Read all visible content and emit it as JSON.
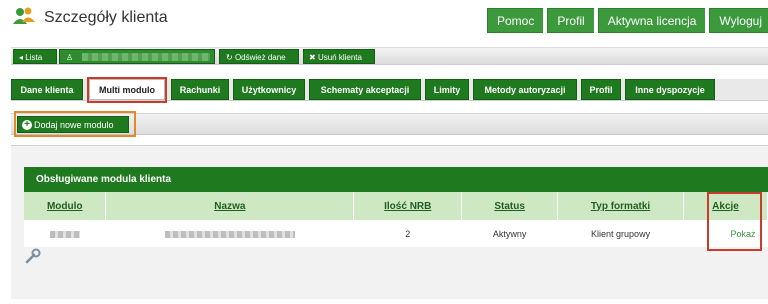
{
  "header": {
    "title": "Szczegóły klienta",
    "buttons": [
      "Pomoc",
      "Profil",
      "Aktywna licencja",
      "Wyloguj"
    ]
  },
  "client_bar": {
    "list_label": "Lista",
    "refresh_label": "Odśwież dane",
    "delete_label": "Usuń klienta"
  },
  "tabs": [
    {
      "label": "Dane klienta",
      "active": false
    },
    {
      "label": "Multi modulo",
      "active": true
    },
    {
      "label": "Rachunki",
      "active": false
    },
    {
      "label": "Użytkownicy",
      "active": false
    },
    {
      "label": "Schematy akceptacji",
      "active": false
    },
    {
      "label": "Limity",
      "active": false
    },
    {
      "label": "Metody autoryzacji",
      "active": false
    },
    {
      "label": "Profil",
      "active": false
    },
    {
      "label": "Inne dyspozycje",
      "active": false
    }
  ],
  "toolbar": {
    "add_label": "Dodaj nowe modulo"
  },
  "section": {
    "title": "Obsługiwane modula klienta"
  },
  "table": {
    "headers": [
      "Modulo",
      "Nazwa",
      "Ilość NRB",
      "Status",
      "Typ formatki",
      "Akcje"
    ],
    "rows": [
      {
        "nrb": "2",
        "status": "Aktywny",
        "typ": "Klient grupowy",
        "action": "Pokaż"
      }
    ]
  },
  "colors": {
    "brand_green": "#1f7a1f",
    "highlight_red": "#c93b2b",
    "highlight_orange": "#e08a2c"
  },
  "icons": [
    "users-icon",
    "arrow-left-icon",
    "user-icon",
    "refresh-icon",
    "delete-icon",
    "plus-circle-icon",
    "wrench-icon"
  ]
}
